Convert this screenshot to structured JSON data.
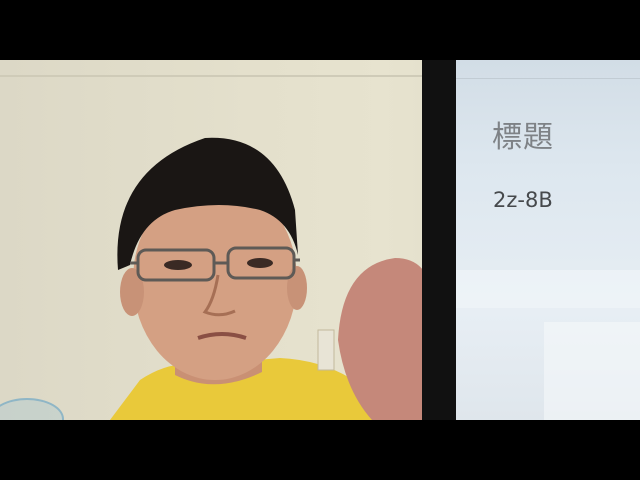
{
  "phone_screen": {
    "title": "標題",
    "value": "2z-8B"
  }
}
